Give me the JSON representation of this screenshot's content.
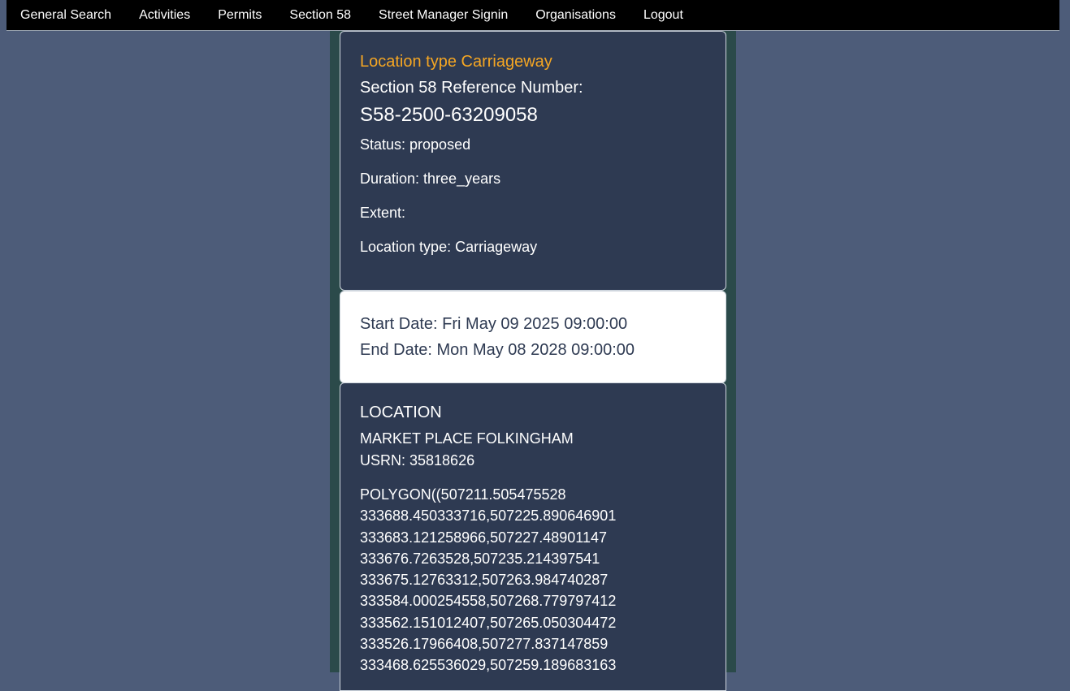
{
  "nav": {
    "items": [
      "General Search",
      "Activities",
      "Permits",
      "Section 58",
      "Street Manager Signin",
      "Organisations",
      "Logout"
    ]
  },
  "info": {
    "location_type_heading": "Location type Carriageway",
    "reference_label": "Section 58 Reference Number:",
    "reference_number": "S58-2500-63209058",
    "status": "Status: proposed",
    "duration": "Duration: three_years",
    "extent": "Extent:",
    "location_type": "Location type: Carriageway"
  },
  "dates": {
    "start": "Start Date: Fri May 09 2025 09:00:00",
    "end": "End Date: Mon May 08 2028 09:00:00"
  },
  "location": {
    "heading": "LOCATION",
    "street": "MARKET PLACE FOLKINGHAM",
    "usrn": "USRN: 35818626",
    "polygon": "POLYGON((507211.505475528 333688.450333716,507225.890646901 333683.121258966,507227.48901147 333676.7263528,507235.214397541 333675.12763312,507263.984740287 333584.000254558,507268.779797412 333562.151012407,507265.050304472 333526.17966408,507277.837147859 333468.625536029,507259.189683163"
  },
  "colors": {
    "page_background": "#4d5c79",
    "navbar": "#000000",
    "card_dark": "#2e3a52",
    "card_light": "#ffffff",
    "accent_orange": "#f5a623",
    "column_background": "#2b4a4a"
  }
}
